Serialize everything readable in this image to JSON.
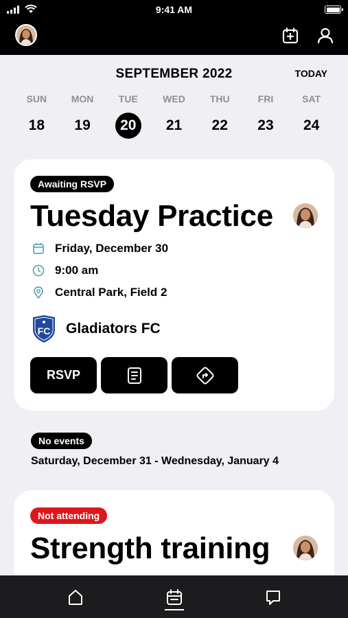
{
  "status": {
    "time": "9:41 AM"
  },
  "header": {
    "avatar": "avatar-girl",
    "add_event_icon": "calendar-plus-icon",
    "profile_icon": "person-icon"
  },
  "calendar": {
    "month": "SEPTEMBER 2022",
    "today_label": "TODAY",
    "weekdays": [
      "SUN",
      "MON",
      "TUE",
      "WED",
      "THU",
      "FRI",
      "SAT"
    ],
    "dates": [
      "18",
      "19",
      "20",
      "21",
      "22",
      "23",
      "24"
    ],
    "selected": "20"
  },
  "events": [
    {
      "status": "Awaiting RSVP",
      "title": "Tuesday Practice",
      "date": "Friday, December 30",
      "time": "9:00 am",
      "location": "Central Park, Field 2",
      "team": "Gladiators FC",
      "crest_text": "FC",
      "actions": {
        "rsvp": "RSVP",
        "details_icon": "document-icon",
        "directions_icon": "directions-icon"
      }
    },
    {
      "status": "Not attending",
      "title": "Strength training"
    }
  ],
  "gap": {
    "badge": "No events",
    "range": "Saturday, December 31 - Wednesday, January 4"
  },
  "nav": {
    "home": "home-icon",
    "calendar": "calendar-icon",
    "chat": "chat-icon"
  },
  "colors": {
    "accent": "#000000",
    "status_red": "#e0161d",
    "icon_teal": "#5aa5b8",
    "crest_blue": "#1f4a9c"
  }
}
